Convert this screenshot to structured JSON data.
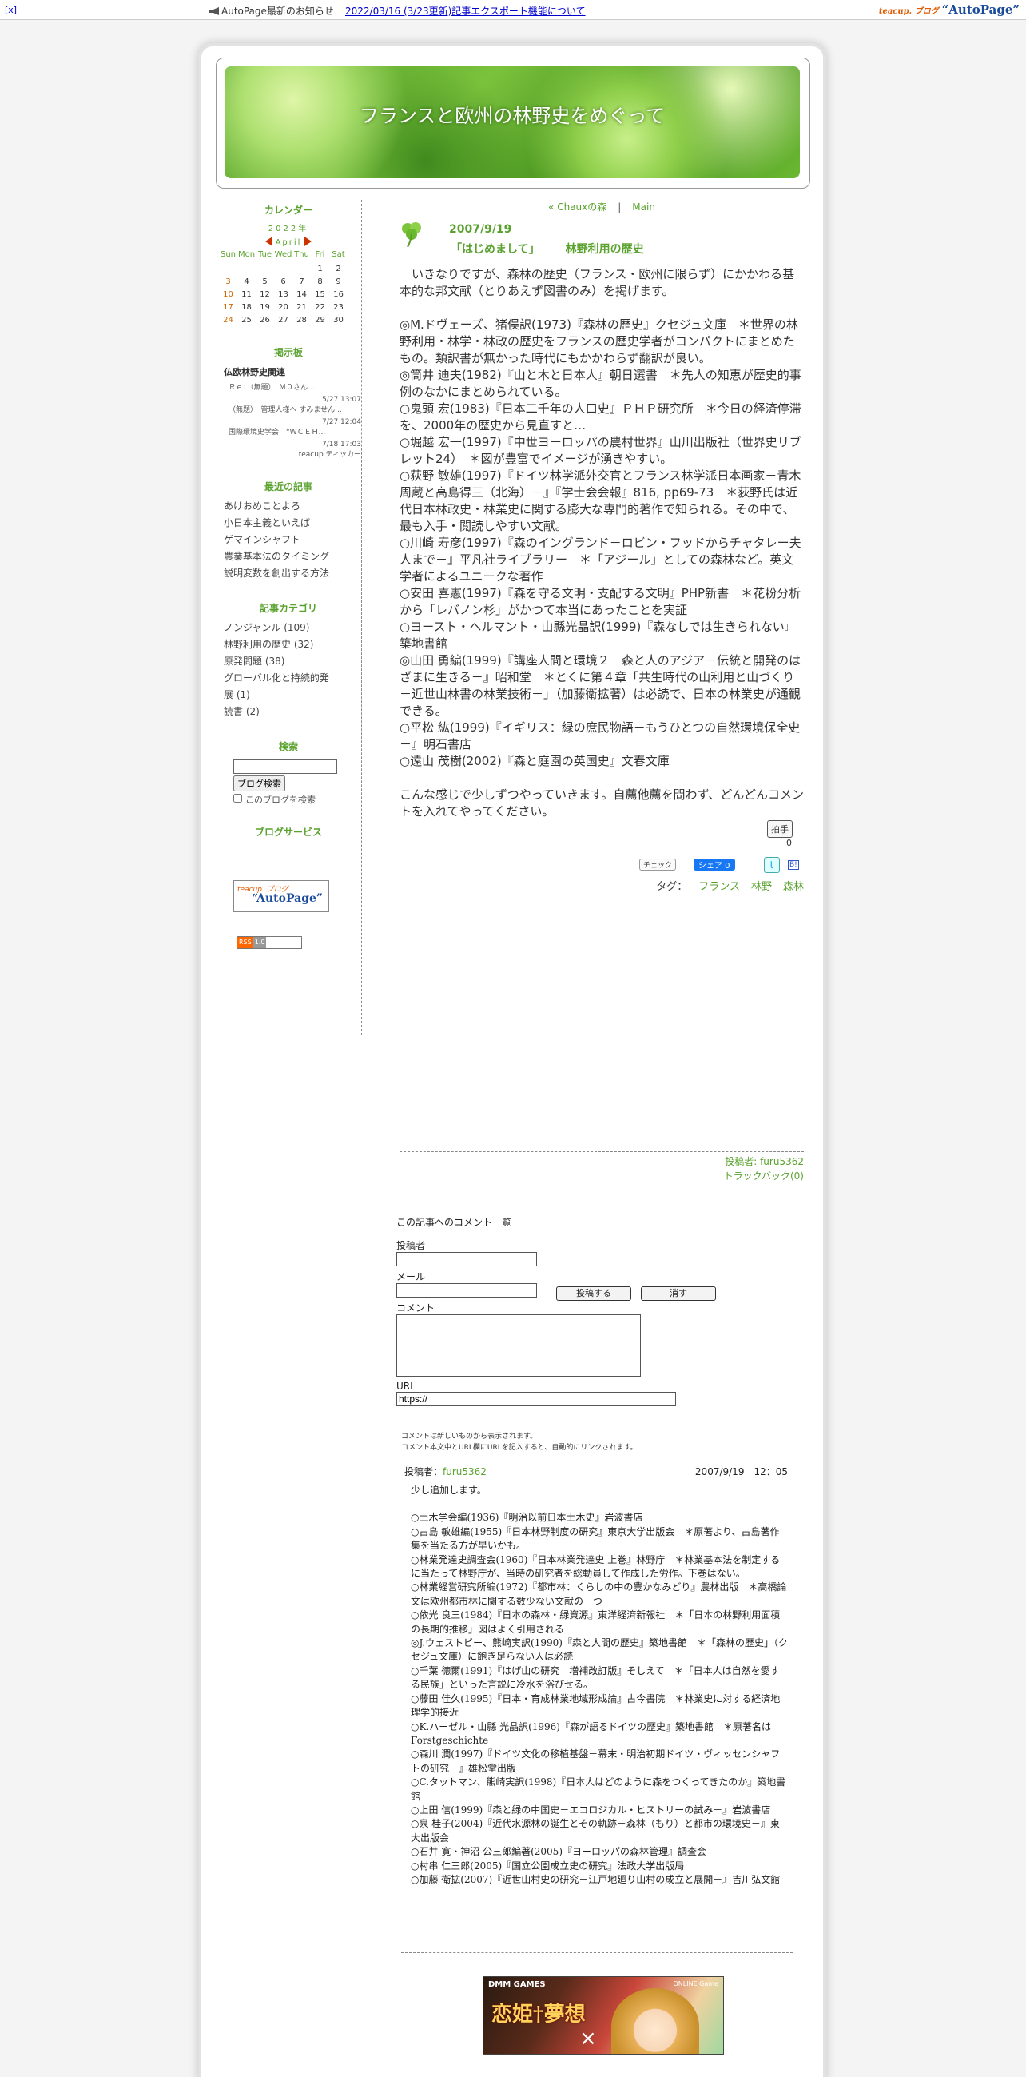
{
  "topbar": {
    "close": "[x]",
    "notice": "AutoPage最新のお知らせ",
    "news": "2022/03/16 (3/23更新)記事エクスポート機能について",
    "logo_teacup": "teacup. ブログ",
    "logo": "“AutoPage”"
  },
  "header": {
    "title": "フランスと欧州の林野史をめぐって"
  },
  "sidebar": {
    "calendar_title": "カレンダー",
    "year": "2022年",
    "month": "April",
    "weekdays": [
      "Sun",
      "Mon",
      "Tue",
      "Wed",
      "Thu",
      "Fri",
      "Sat"
    ],
    "weeks": [
      [
        "",
        "",
        "",
        "",
        "",
        "1",
        "2"
      ],
      [
        "3",
        "4",
        "5",
        "6",
        "7",
        "8",
        "9"
      ],
      [
        "10",
        "11",
        "12",
        "13",
        "14",
        "15",
        "16"
      ],
      [
        "17",
        "18",
        "19",
        "20",
        "21",
        "22",
        "23"
      ],
      [
        "24",
        "25",
        "26",
        "27",
        "28",
        "29",
        "30"
      ]
    ],
    "bbs_title": "掲示板",
    "bbs_name": "仏欧林野史関連",
    "bbs_entries": [
      {
        "text": "Ｒｅ：（無題）　Ｍ０さん...",
        "date": "5/27 13:07"
      },
      {
        "text": "（無題）　管理人様へ すみません...",
        "date": "7/27 12:04"
      },
      {
        "text": "国際環境史学会　“ＷＣＥＨ...",
        "date": "7/18 17:03"
      }
    ],
    "bbs_ticker": "teacup.ティッカー",
    "recent_title": "最近の記事",
    "recent": [
      "あけおめことよろ",
      "小日本主義といえば",
      "ゲマインシャフト",
      "農業基本法のタイミング",
      "説明変数を創出する方法"
    ],
    "cat_title": "記事カテゴリ",
    "categories": [
      "ノンジャンル (109)",
      "林野利用の歴史 (32)",
      "原発問題 (38)",
      "グローバル化と持続的発展 (1)",
      "読書 (2)"
    ],
    "search_title": "検索",
    "search_button": "ブログ検索",
    "search_check": "このブログを検索",
    "service_title": "ブログサービス",
    "tc_small": "teacup. ブログ",
    "tc_big": "“AutoPage”",
    "rss_a": "RSS",
    "rss_b": "1.0"
  },
  "article": {
    "nav_prev": "« Chauxの森",
    "nav_sep": "|",
    "nav_main": "Main",
    "date": "2007/9/19",
    "title": "「はじめまして」",
    "category": "林野利用の歴史",
    "paragraphs": [
      "　いきなりですが、森林の歴史（フランス・欧州に限らず）にかかわる基本的な邦文献（とりあえず図書のみ）を掲げます。",
      "",
      "◎M.ドヴェーズ、猪俣訳(1973)『森林の歴史』クセジュ文庫　＊世界の林野利用・林学・林政の歴史をフランスの歴史学者がコンパクトにまとめたもの。類訳書が無かった時代にもかかわらず翻訳が良い。",
      "◎筒井 迪夫(1982)『山と木と日本人』朝日選書　＊先人の知恵が歴史的事例のなかにまとめられている。",
      "○鬼頭 宏(1983)『日本二千年の人口史』ＰＨＰ研究所　＊今日の経済停滞を、2000年の歴史から見直すと…",
      "○堀越 宏一(1997)『中世ヨーロッパの農村世界』山川出版社（世界史リブレット24）　＊図が豊富でイメージが湧きやすい。",
      "○荻野 敏雄(1997)『ドイツ林学派外交官とフランス林学派日本画家－青木周蔵と高島得三（北海）－』『学士会会報』816, pp69-73　＊荻野氏は近代日本林政史・林業史に関する膨大な専門的著作で知られる。その中で、最も入手・閲読しやすい文献。",
      "○川崎 寿彦(1997)『森のイングランド－ロビン・フッドからチャタレー夫人まで－』平凡社ライブラリー　＊「アジール」としての森林など。英文学者によるユニークな著作",
      "○安田 喜憲(1997)『森を守る文明・支配する文明』PHP新書　＊花粉分析から「レバノン杉」がかつて本当にあったことを実証",
      "○ヨースト・ヘルマント・山縣光晶訳(1999)『森なしでは生きられない』築地書館",
      "◎山田 勇編(1999)『講座人間と環境２　森と人のアジア－伝統と開発のはざまに生きる－』昭和堂　＊とくに第４章「共生時代の山利用と山づくり－近世山林書の林業技術－」（加藤衛拡著）は必読で、日本の林業史が通観できる。",
      "○平松 紘(1999)『イギリス：緑の庶民物語－もうひとつの自然環境保全史－』明石書店",
      "○遠山 茂樹(2002)『森と庭園の英国史』文春文庫",
      "",
      "こんな感じで少しずつやっていきます。自薦他薦を問わず、どんどんコメントを入れてやってください。"
    ],
    "pat_button": "拍手",
    "pat_count": "0",
    "check": "チェック",
    "fb_share": "シェア 0",
    "tw": "t",
    "hb": "B!",
    "tags_label": "タグ：",
    "tags": [
      "フランス",
      "林野",
      "森林"
    ],
    "poster": "投稿者: furu5362",
    "trackback": "トラックバック(0)"
  },
  "comment_form": {
    "list_title": "この記事へのコメント一覧",
    "author_label": "投稿者",
    "mail_label": "メール",
    "comment_label": "コメント",
    "url_label": "URL",
    "url_value": "https://",
    "submit": "投稿する",
    "clear": "消す",
    "note1": "コメントは新しいものから表示されます。",
    "note2": "コメント本文中とURL欄にURLを記入すると、自動的にリンクされます。"
  },
  "comment": {
    "author_label": "投稿者：",
    "author": "furu5362",
    "date": "2007/9/19　12：05",
    "lines": [
      "少し追加します。",
      "",
      "○土木学会編(1936)『明治以前日本土木史』岩波書店",
      "○古島 敏雄編(1955)『日本林野制度の研究』東京大学出版会　＊原著より、古島著作集を当たる方が早いかも。",
      "○林業発達史調査会(1960)『日本林業発達史 上巻』林野庁　＊林業基本法を制定するに当たって林野庁が、当時の研究者を総動員して作成した労作。下巻はない。",
      "○林業経営研究所編(1972)『都市林：くらしの中の豊かなみどり』農林出版　＊高橋論文は欧州都市林に関する数少ない文献の一つ",
      "○依光 良三(1984)『日本の森林・緑資源』東洋経済新報社　＊「日本の林野利用面積の長期的推移」図はよく引用される",
      "◎J.ウェストビー、熊崎実訳(1990)『森と人間の歴史』築地書館　＊「森林の歴史」（クセジュ文庫）に飽き足らない人は必読",
      "○千葉 徳爾(1991)『はげ山の研究　増補改訂版』そしえて　＊「日本人は自然を愛する民族」といった言説に冷水を浴びせる。",
      "○藤田 佳久(1995)『日本・育成林業地域形成論』古今書院　＊林業史に対する経済地理学的接近",
      "○K.ハーゼル・山縣 光晶訳(1996)『森が語るドイツの歴史』築地書館　＊原著名はForstgeschichte",
      "○森川 潤(1997)『ドイツ文化の移植基盤－幕末・明治初期ドイツ・ヴィッセンシャフトの研究－』雄松堂出版",
      "○C.タットマン、熊崎実訳(1998)『日本人はどのように森をつくってきたのか』築地書館",
      "○上田 信(1999)『森と緑の中国史－エコロジカル・ヒストリーの試み－』岩波書店",
      "○泉 桂子(2004)『近代水源林の誕生とその軌跡－森林（もり）と都市の環境史－』東大出版会",
      "○石井 寛・神沼 公三郎編著(2005)『ヨーロッパの森林管理』調査会",
      "○村串 仁三郎(2005)『国立公園成立史の研究』法政大学出版局",
      "○加藤 衛拡(2007)『近世山村史の研究－江戸地廻り山村の成立と展開－』吉川弘文館"
    ]
  },
  "ad": {
    "brand": "DMM GAMES",
    "tag": "ONLINE Game",
    "title": "恋姫†夢想",
    "x": "×"
  },
  "colors": {
    "accent": "#5aa22e",
    "link": "#0000cc"
  }
}
